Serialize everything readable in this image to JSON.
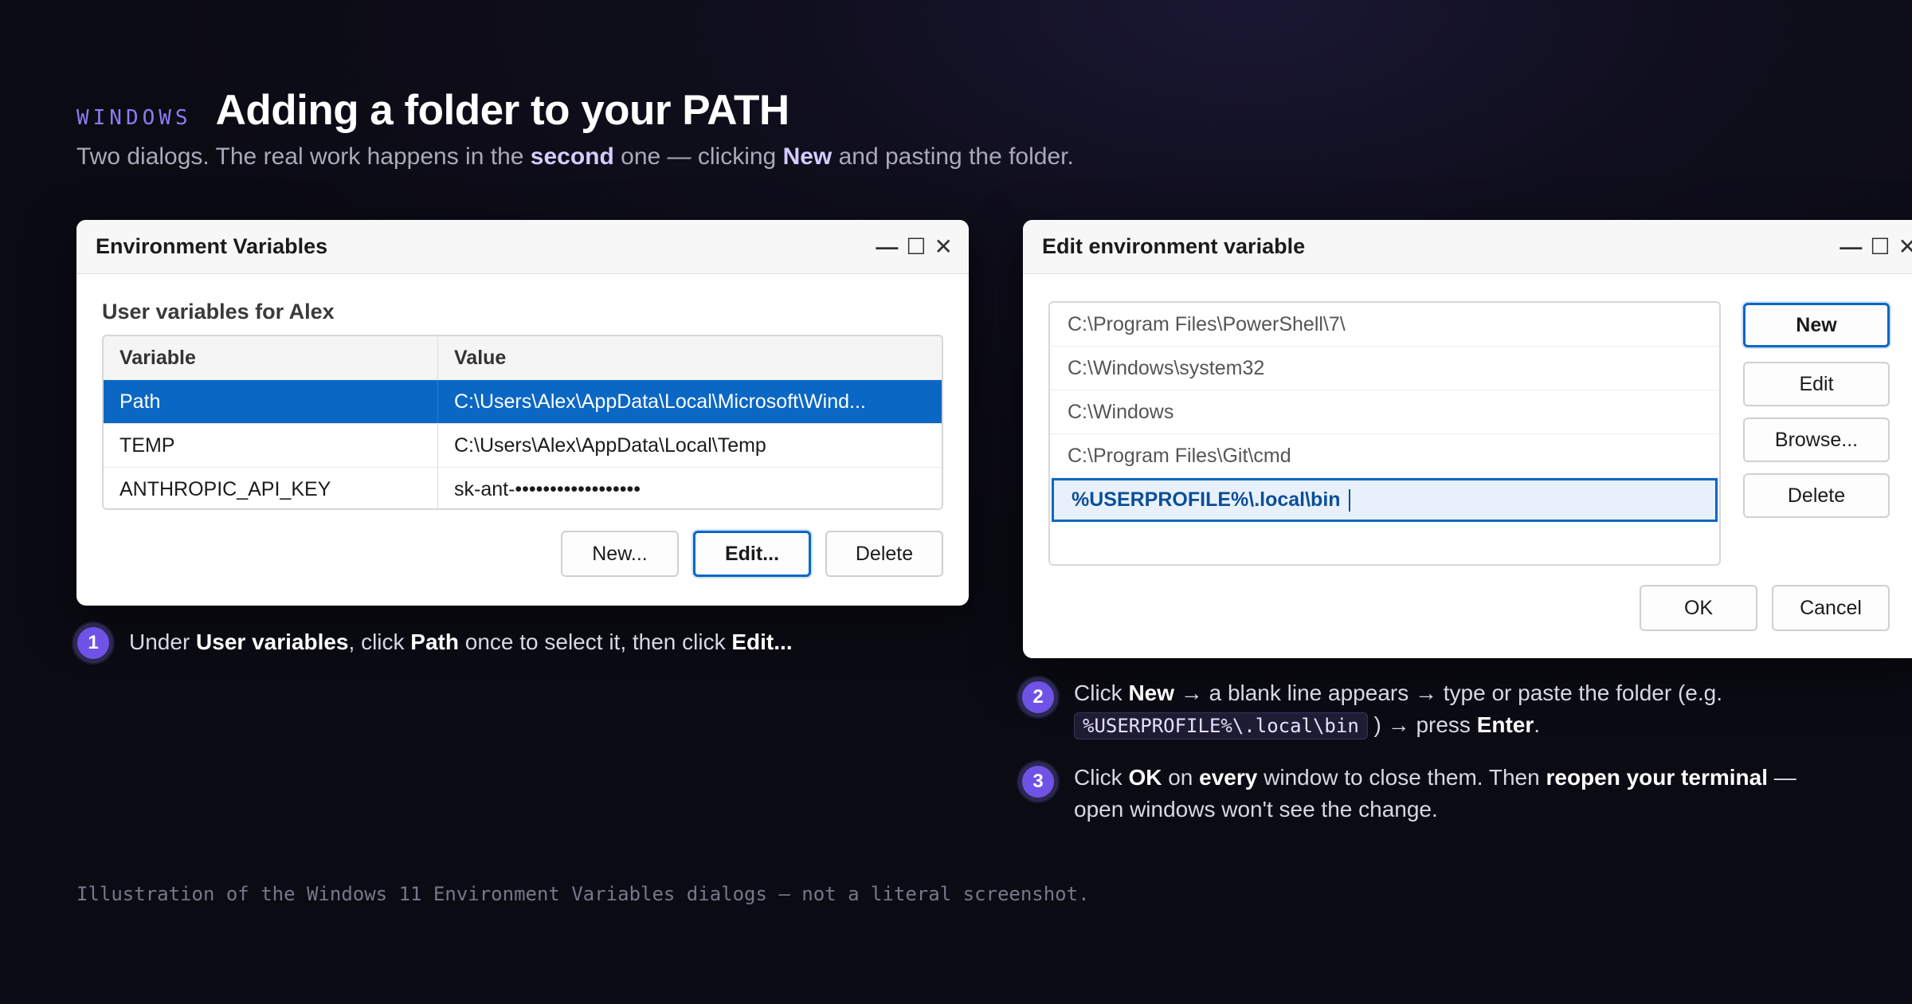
{
  "header": {
    "eyebrow": "WINDOWS",
    "title": "Adding a folder to your PATH",
    "subtitle": {
      "p1": "Two dialogs. The real work happens in the ",
      "b1": "second",
      "p2": " one — clicking ",
      "b2": "New",
      "p3": " and pasting the folder."
    }
  },
  "dialog1": {
    "title": "Environment Variables",
    "controls": {
      "minimize": "—",
      "maximize": "☐",
      "close": "✕"
    },
    "section_label": "User variables for Alex",
    "columns": [
      "Variable",
      "Value"
    ],
    "rows": [
      {
        "variable": "Path",
        "value": "C:\\Users\\Alex\\AppData\\Local\\Microsoft\\Wind...",
        "selected": true
      },
      {
        "variable": "TEMP",
        "value": "C:\\Users\\Alex\\AppData\\Local\\Temp",
        "selected": false
      },
      {
        "variable": "ANTHROPIC_API_KEY",
        "value": "sk-ant-••••••••••••••••••",
        "selected": false
      }
    ],
    "buttons": {
      "new": "New...",
      "edit": "Edit...",
      "delete": "Delete"
    }
  },
  "dialog2": {
    "title": "Edit environment variable",
    "controls": {
      "minimize": "—",
      "maximize": "☐",
      "close": "✕"
    },
    "paths": [
      "C:\\Program Files\\PowerShell\\7\\",
      "C:\\Windows\\system32",
      "C:\\Windows",
      "C:\\Program Files\\Git\\cmd"
    ],
    "editing_path": "%USERPROFILE%\\.local\\bin",
    "side_buttons": {
      "new": "New",
      "edit": "Edit",
      "browse": "Browse...",
      "delete": "Delete"
    },
    "footer_buttons": {
      "ok": "OK",
      "cancel": "Cancel"
    }
  },
  "steps": [
    {
      "number": "1",
      "t1": "Under ",
      "b1": "User variables",
      "t2": ", click ",
      "b2": "Path",
      "t3": " once to select it, then click ",
      "b3": "Edit..."
    },
    {
      "number": "2",
      "t1": "Click ",
      "b1": "New",
      "t2": " → a blank line appears → type or paste the folder (e.g. ",
      "code": "%USERPROFILE%\\.local\\bin",
      "t3": " ) → press ",
      "b2": "Enter",
      "t4": "."
    },
    {
      "number": "3",
      "t1": "Click ",
      "b1": "OK",
      "t2": " on ",
      "b2": "every",
      "t3": " window to close them. Then ",
      "b3": "reopen your terminal",
      "t4": " — open windows won't see the change."
    }
  ],
  "footnote": "Illustration of the Windows 11 Environment Variables dialogs — not a literal screenshot.",
  "colors": {
    "accent": "#6f52e6",
    "selection": "#0b67c4",
    "eyebrow": "#8b7cf0"
  }
}
